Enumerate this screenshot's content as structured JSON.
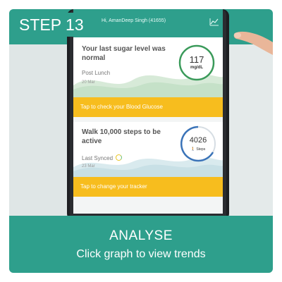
{
  "step_label": "STEP 13",
  "header": {
    "greeting": "Hi, AmanDeep Singh (41655)",
    "graph_icon": "graph-icon",
    "avatar_icon": "avatar-icon"
  },
  "sugar_card": {
    "title": "Your last sugar level was normal",
    "meal": "Post Lunch",
    "date": "20 Mar",
    "value": "117",
    "unit": "mg/dL",
    "action": "Tap to check your Blood Glucose"
  },
  "steps_card": {
    "title": "Walk 10,000 steps to be active",
    "synced": "Last Synced",
    "date": "23 Mar",
    "value": "4026",
    "unit": "Steps",
    "action": "Tap to change your tracker"
  },
  "footer": {
    "title": "ANALYSE",
    "subtitle": "Click graph to view trends"
  },
  "colors": {
    "teal": "#2e9f8c",
    "yellow": "#f7bd1e",
    "green_ring": "#3a9a5a",
    "blue_ring": "#3a73b8"
  }
}
